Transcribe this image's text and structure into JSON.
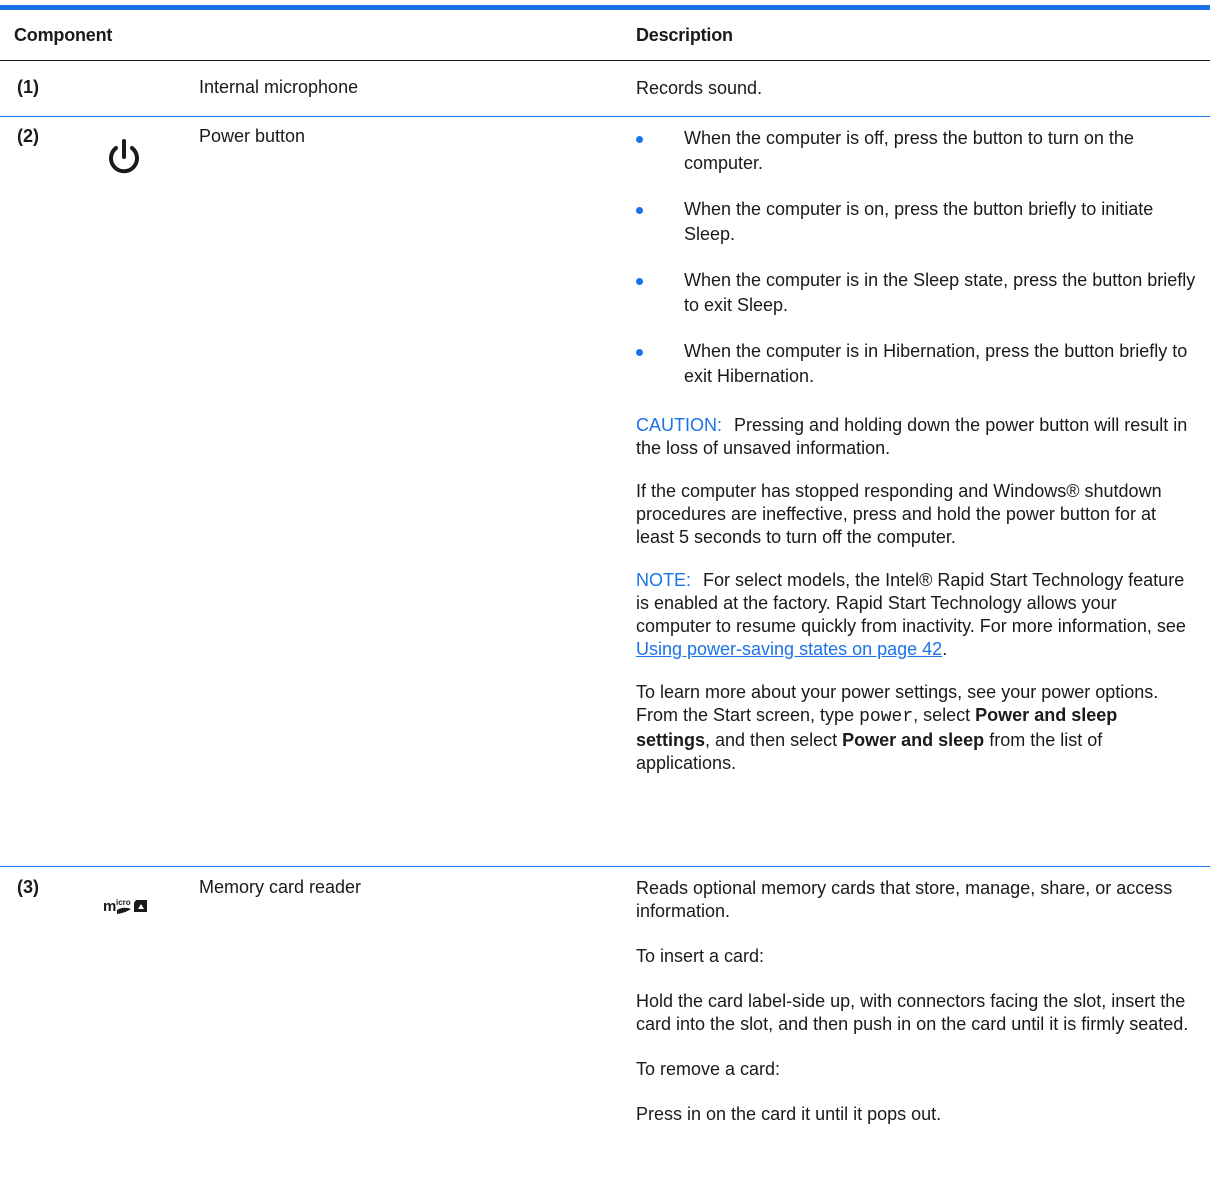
{
  "header": {
    "component": "Component",
    "description": "Description"
  },
  "rows": [
    {
      "number": "(1)",
      "name": "Internal microphone",
      "description": "Records sound."
    },
    {
      "number": "(2)",
      "icon": "power-icon",
      "name": "Power button",
      "bullets": [
        "When the computer is off, press the button to turn on the computer.",
        "When the computer is on, press the button briefly to initiate Sleep.",
        "When the computer is in the Sleep state, press the button briefly to exit Sleep.",
        "When the computer is in Hibernation, press the button briefly to exit Hibernation."
      ],
      "caution_label": "CAUTION:",
      "caution_text": "Pressing and holding down the power button will result in the loss of unsaved information.",
      "para_unresponsive": "If the computer has stopped responding and Windows® shutdown procedures are ineffective, press and hold the power button for at least 5 seconds to turn off the computer.",
      "note_label": "NOTE:",
      "note_text": "For select models, the Intel® Rapid Start Technology feature is enabled at the factory. Rapid Start Technology allows your computer to resume quickly from inactivity. For more information, see",
      "note_link": "Using power-saving states on page 42",
      "note_end": ".",
      "settings_1": "To learn more about your power settings, see your power options. From the Start screen, type",
      "settings_code": "power",
      "settings_2": ", select",
      "settings_bold_1": "Power and sleep settings",
      "settings_3": ", and then select",
      "settings_bold_2": "Power and sleep",
      "settings_4": "from the list of applications."
    },
    {
      "number": "(3)",
      "icon": "microsd-icon",
      "name": "Memory card reader",
      "paragraphs": [
        "Reads optional memory cards that store, manage, share, or access information.",
        "To insert a card:",
        "Hold the card label-side up, with connectors facing the slot, insert the card into the slot, and then push in on the card until it is firmly seated.",
        "To remove a card:",
        "Press in on the card it until it pops out."
      ]
    }
  ],
  "colors": {
    "accent": "#1a73e8",
    "text": "#1a1a1a"
  }
}
